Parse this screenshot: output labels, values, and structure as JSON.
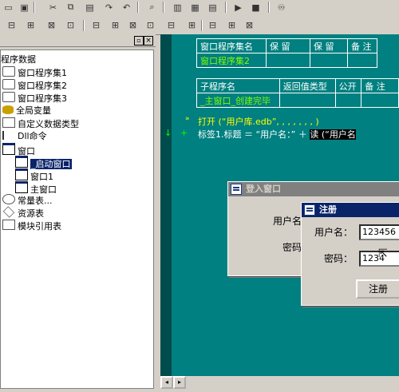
{
  "toolbar": {
    "icons": [
      "folder-icon",
      "save-icon",
      "cut-icon",
      "copy-icon",
      "paste-icon",
      "redo-icon",
      "undo-icon",
      "find-icon",
      "window-icon",
      "window2-icon",
      "window3-icon",
      "run-icon",
      "stop-icon",
      "binoculars-icon"
    ]
  },
  "tree": {
    "items": [
      {
        "label": "程序数据"
      },
      {
        "label": "窗口程序集1"
      },
      {
        "label": "窗口程序集2"
      },
      {
        "label": "窗口程序集3"
      },
      {
        "label": "全局变量"
      },
      {
        "label": "自定义数据类型"
      },
      {
        "label": "Dll命令"
      },
      {
        "label": "窗口"
      },
      {
        "label": "_启动窗口"
      },
      {
        "label": "窗口1"
      },
      {
        "label": "主窗口"
      },
      {
        "label": "常量表..."
      },
      {
        "label": "资源表"
      },
      {
        "label": "模块引用表"
      }
    ]
  },
  "assembly_table": {
    "headers": [
      "窗口程序集名",
      "保 留",
      "保 留",
      "备 注"
    ],
    "row": [
      "窗口程序集2",
      "",
      "",
      ""
    ]
  },
  "sub_table": {
    "headers": [
      "子程序名",
      "返回值类型",
      "公开",
      "备 注"
    ],
    "row": [
      "_主窗口_创建完毕",
      "",
      "",
      ""
    ]
  },
  "code": {
    "line1": "打开 (“用户库.edb”, , , , , , , )",
    "line2_prefix": "标签1.标题 ＝ “用户名：” ＋ ",
    "line2_highlight": "读 (“用户名"
  },
  "login_dialog": {
    "title": "登入窗口",
    "user_label": "用户名",
    "pass_label": "密码"
  },
  "register_dialog": {
    "title": "注册",
    "user_label": "用户名：",
    "user_value": "123456",
    "pass_label": "密码：",
    "pass_value": "1234",
    "button": "注册"
  }
}
